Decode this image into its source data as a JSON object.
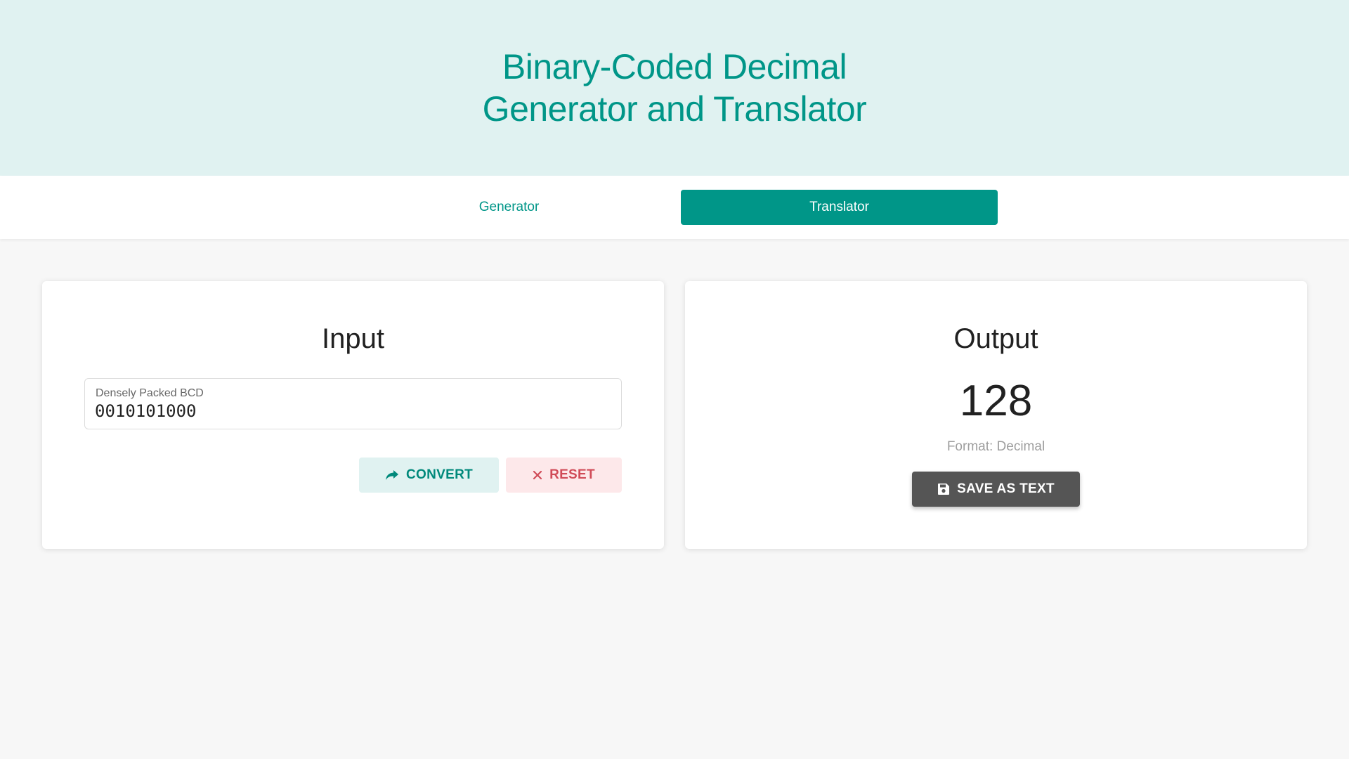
{
  "header": {
    "title_line1": "Binary-Coded Decimal",
    "title_line2": "Generator and Translator"
  },
  "tabs": [
    {
      "label": "Generator",
      "active": false
    },
    {
      "label": "Translator",
      "active": true
    }
  ],
  "input_card": {
    "title": "Input",
    "field_label": "Densely Packed BCD",
    "field_value": "0010101000",
    "convert_label": "CONVERT",
    "reset_label": "RESET"
  },
  "output_card": {
    "title": "Output",
    "result": "128",
    "format_text": "Format: Decimal",
    "save_label": "SAVE AS TEXT"
  },
  "colors": {
    "accent": "#009688",
    "header_bg": "#e0f2f1",
    "reset_text": "#d04b58",
    "save_bg": "#555555"
  },
  "icons": {
    "convert": "share-arrow-icon",
    "reset": "close-icon",
    "save": "floppy-disk-icon"
  }
}
